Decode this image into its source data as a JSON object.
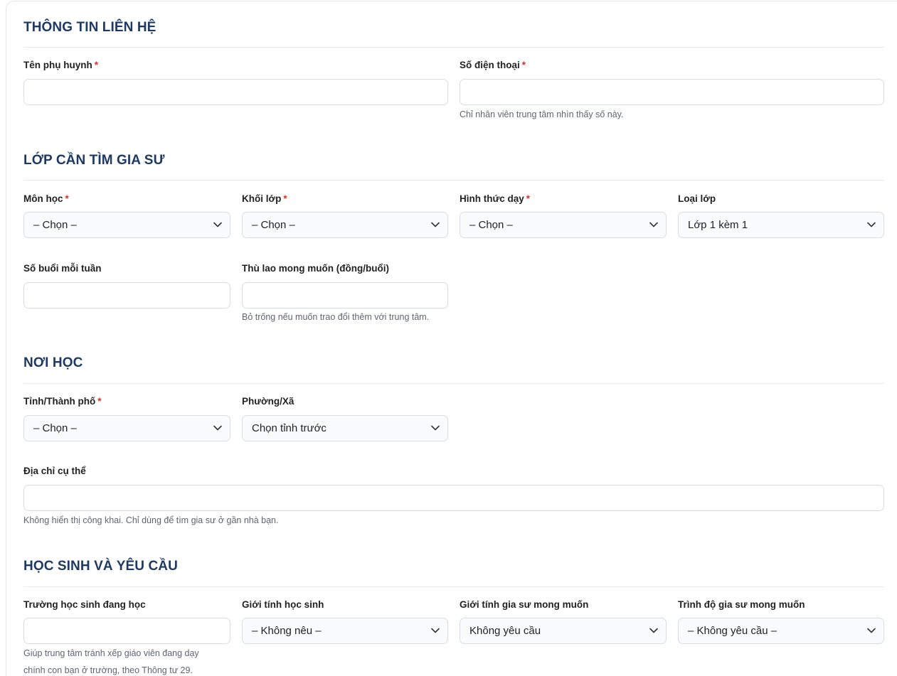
{
  "sections": {
    "contact": {
      "title": "THÔNG TIN LIÊN HỆ"
    },
    "class": {
      "title": "LỚP CẦN TÌM GIA SƯ"
    },
    "location": {
      "title": "NƠI HỌC"
    },
    "student": {
      "title": "HỌC SINH VÀ YÊU CẦU"
    }
  },
  "fields": {
    "parent_name": {
      "label": "Tên phụ huynh",
      "required": "*",
      "value": ""
    },
    "phone": {
      "label": "Số điện thoại",
      "required": "*",
      "value": "",
      "hint": "Chỉ nhân viên trung tâm nhìn thấy số này."
    },
    "subject": {
      "label": "Môn học",
      "required": "*",
      "selected": "– Chọn –"
    },
    "grade": {
      "label": "Khối lớp",
      "required": "*",
      "selected": "– Chọn –"
    },
    "teaching_mode": {
      "label": "Hình thức dạy",
      "required": "*",
      "selected": "– Chọn –"
    },
    "class_type": {
      "label": "Loại lớp",
      "selected": "Lớp 1 kèm 1"
    },
    "sessions_per_week": {
      "label": "Số buổi mỗi tuần",
      "value": ""
    },
    "fee": {
      "label": "Thù lao mong muốn (đồng/buổi)",
      "value": "",
      "hint": "Bỏ trống nếu muốn trao đổi thêm với trung tâm."
    },
    "province": {
      "label": "Tỉnh/Thành phố",
      "required": "*",
      "selected": "– Chọn –"
    },
    "ward": {
      "label": "Phường/Xã",
      "selected": "Chọn tỉnh trước"
    },
    "address": {
      "label": "Địa chỉ cụ thể",
      "value": "",
      "hint": "Không hiển thị công khai. Chỉ dùng để tìm gia sư ở gần nhà bạn."
    },
    "school": {
      "label": "Trường học sinh đang học",
      "value": "",
      "hint_line1": "Giúp trung tâm tránh xếp giáo viên đang dạy",
      "hint_line2": "chính con bạn ở trường, theo Thông tư 29."
    },
    "student_gender": {
      "label": "Giới tính học sinh",
      "selected": "– Không nêu –"
    },
    "tutor_gender": {
      "label": "Giới tính gia sư mong muốn",
      "selected": "Không yêu cầu"
    },
    "tutor_level": {
      "label": "Trình độ gia sư mong muốn",
      "selected": "– Không yêu cầu –"
    }
  },
  "icons": {
    "select_arrow": "chevron-down-icon"
  },
  "colors": {
    "heading": "#1e3a64",
    "required": "#d93025",
    "border": "#d8dde4"
  }
}
